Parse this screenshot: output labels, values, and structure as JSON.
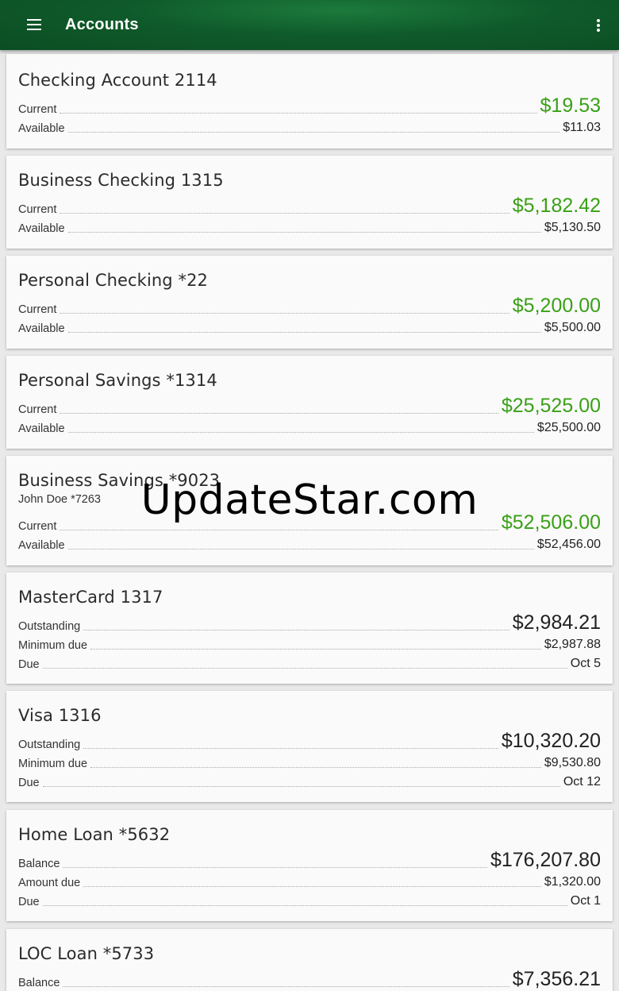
{
  "appbar": {
    "title": "Accounts"
  },
  "watermark": "UpdateStar.com",
  "colors": {
    "appbar": "#0f5a2a",
    "positive_amount": "#3aa017"
  },
  "accounts": [
    {
      "name": "Checking Account 2114",
      "rows": [
        {
          "label": "Current",
          "value": "$19.53"
        },
        {
          "label": "Available",
          "value": "$11.03"
        }
      ]
    },
    {
      "name": "Business Checking 1315",
      "rows": [
        {
          "label": "Current",
          "value": "$5,182.42"
        },
        {
          "label": "Available",
          "value": "$5,130.50"
        }
      ]
    },
    {
      "name": "Personal Checking *22",
      "rows": [
        {
          "label": "Current",
          "value": "$5,200.00"
        },
        {
          "label": "Available",
          "value": "$5,500.00"
        }
      ]
    },
    {
      "name": "Personal Savings *1314",
      "rows": [
        {
          "label": "Current",
          "value": "$25,525.00"
        },
        {
          "label": "Available",
          "value": "$25,500.00"
        }
      ]
    },
    {
      "name": "Business Savings *9023",
      "sub": "John Doe *7263",
      "rows": [
        {
          "label": "Current",
          "value": "$52,506.00"
        },
        {
          "label": "Available",
          "value": "$52,456.00"
        }
      ]
    },
    {
      "name": "MasterCard 1317",
      "rows": [
        {
          "label": "Outstanding",
          "value": "$2,984.21"
        },
        {
          "label": "Minimum due",
          "value": "$2,987.88"
        },
        {
          "label": "Due",
          "value": "Oct 5"
        }
      ]
    },
    {
      "name": "Visa 1316",
      "rows": [
        {
          "label": "Outstanding",
          "value": "$10,320.20"
        },
        {
          "label": "Minimum due",
          "value": "$9,530.80"
        },
        {
          "label": "Due",
          "value": "Oct 12"
        }
      ]
    },
    {
      "name": "Home Loan *5632",
      "rows": [
        {
          "label": "Balance",
          "value": "$176,207.80"
        },
        {
          "label": "Amount due",
          "value": "$1,320.00"
        },
        {
          "label": "Due",
          "value": "Oct 1"
        }
      ]
    },
    {
      "name": "LOC Loan *5733",
      "rows": [
        {
          "label": "Balance",
          "value": "$7,356.21"
        }
      ]
    }
  ]
}
